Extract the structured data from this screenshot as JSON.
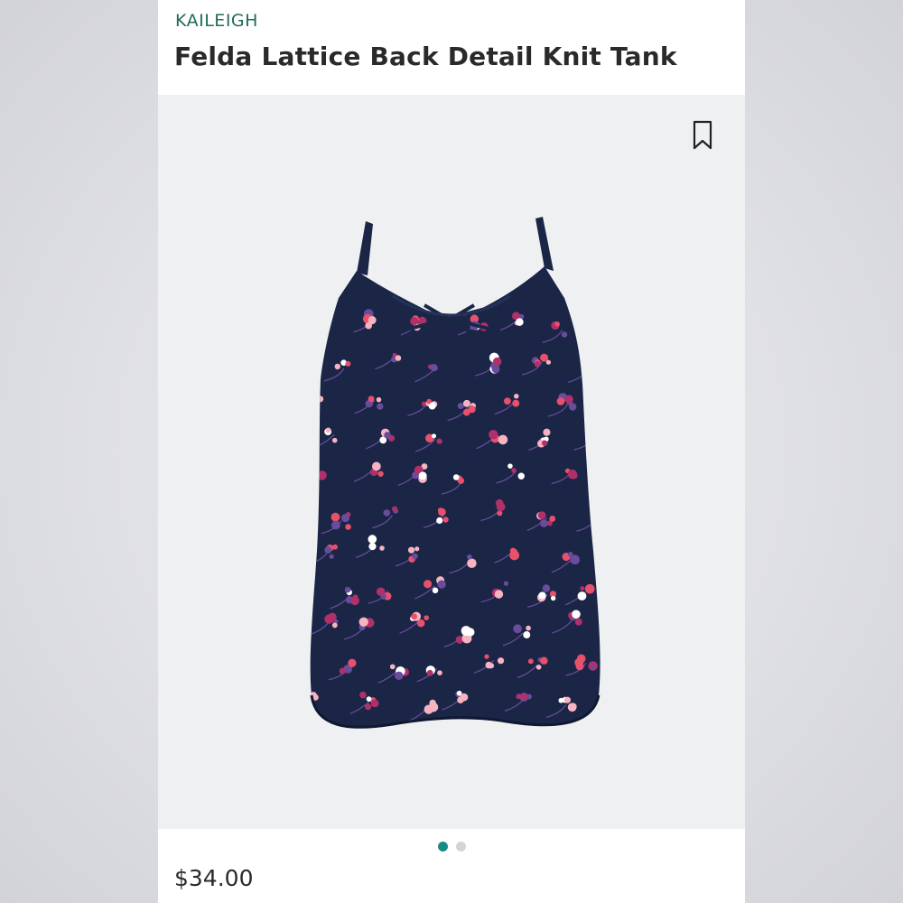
{
  "product": {
    "brand": "KAILEIGH",
    "title": "Felda Lattice Back Detail Knit Tank",
    "price": "$34.00",
    "image": {
      "icon": "tank-top-image",
      "garment_color": "#1b2647",
      "print_colors": [
        "#e8506b",
        "#f6b3c0",
        "#ffffff",
        "#b0306a",
        "#6a4c9c"
      ]
    }
  },
  "bookmark": {
    "icon": "bookmark-icon"
  },
  "carousel": {
    "count": 2,
    "active_index": 0,
    "active_color": "#1a8a84",
    "inactive_color": "#d4d4d4"
  },
  "colors": {
    "brand": "#1f6b5a",
    "text": "#2a2a2a",
    "panel": "#eff0f2"
  }
}
